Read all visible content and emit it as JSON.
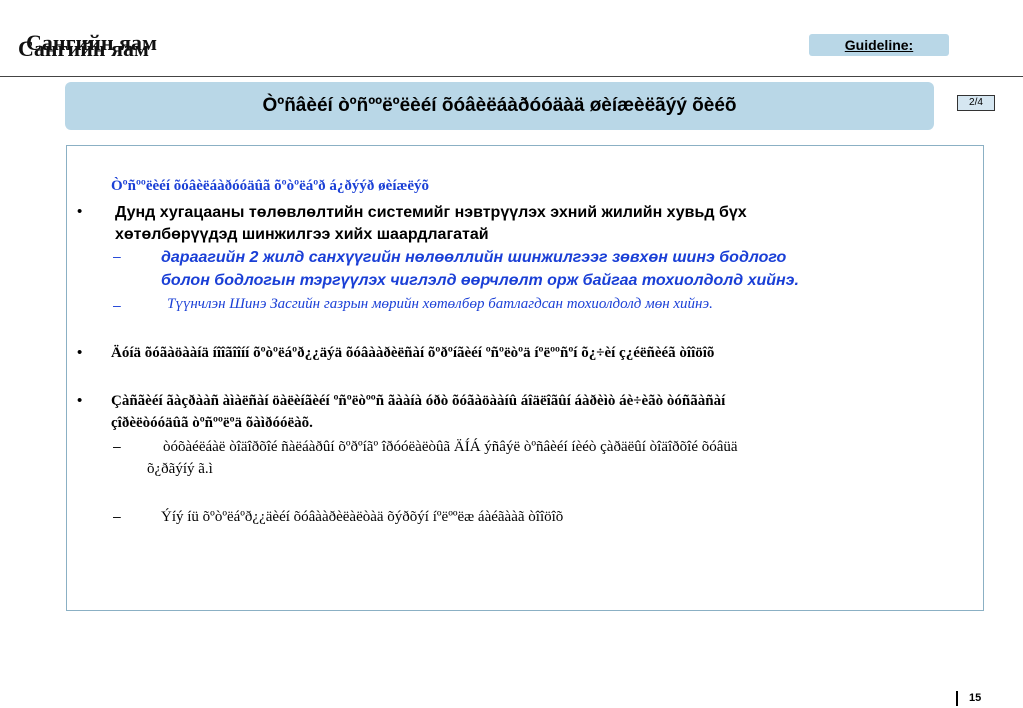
{
  "header": {
    "logo_text_1": "Сангийн яам",
    "logo_text_2": "Сангийн яам",
    "guideline_label": "Guideline:"
  },
  "title": "Òºñâèéí òºñººëºëèéí õóâèëáàðóóäàä  øèíæèëãýý õèéõ",
  "page_badge": "2/4",
  "content": {
    "heading": "Òºñººëèéí õóâèëáàðóóäûã  õºòºëáºð á¿ðýýð øèíæëýõ",
    "bullet1": {
      "line1": "Дунд хугацааны төлөвлөлтийн системийг нэвтрүүлэх эхний жилийн хувьд бүх",
      "line2": "хөтөлбөрүүдэд шинжилгээ хийх шаардлагатай",
      "sub1_line1": "дараагийн 2 жилд санхүүгийн нөлөөллийн шинжилгээг зөвхөн шинэ бодлого",
      "sub1_line2": "болон бодлогын тэргүүлэх чиглэлд өөрчлөлт орж байгаа тохиолдолд хийнэ.",
      "sub2": "Түүнчлэн Шинэ Засгийн газрын мөрийн хөтөлбөр батлагдсан тохиолдолд мөн хийнэ."
    },
    "bullet2": "Äóíä õóãàöààíä íîîãîîíí õºòºëáºð¿¿äýä õóâààðèëñàí õºðºíãèéí ºñºëòºä íºëººñºí õ¿÷èí ç¿éëñèéã òîîöîõ",
    "bullet3": {
      "line1": "Çàñãèéí ãàçðààñ àìàëñàí öàëèíãèéí ºñºëòººñ ãààíà óðò õóãàöààíû áîäëîãûí áàðèìò áè÷èãò òóñãàñàí",
      "line2": "çîðèëòóóäûã òºñººëºä õàìðóóëàõ.",
      "sub1_line1": "òóõàéëáàë òîäîðõîé ñàëáàðûí õºðºíãº îðóóëàëòûã ÄÍÁ ýñâýë òºñâèéí íèéò çàðäëûí òîäîðõîé õóâüä",
      "sub1_line2": "õ¿ðãýíý ã.ì",
      "sub2": "Ýíý íü õºòºëáºð¿¿äèéí õóâààðèëàëòàä  õýðõýí íºëººëæ áàéãààã òîîöîõ"
    }
  },
  "footer": {
    "page_number": "15"
  }
}
